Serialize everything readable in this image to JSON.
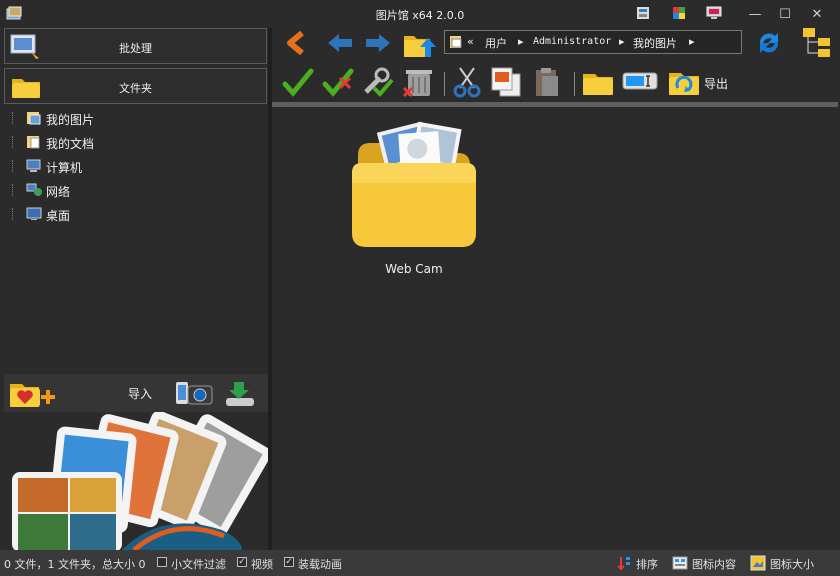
{
  "window": {
    "title": "图片馆 x64 2.0.0",
    "controls": [
      "minimize-icon",
      "maximize-icon",
      "close-icon"
    ]
  },
  "sidebar": {
    "batch_label": "批处理",
    "folder_label": "文件夹",
    "tree": [
      {
        "label": "我的图片",
        "icon": "pictures-folder-icon"
      },
      {
        "label": "我的文档",
        "icon": "documents-folder-icon"
      },
      {
        "label": "计算机",
        "icon": "computer-icon"
      },
      {
        "label": "网络",
        "icon": "network-icon"
      },
      {
        "label": "桌面",
        "icon": "desktop-icon"
      }
    ],
    "import_label": "导入"
  },
  "address": {
    "prefix": "«",
    "segments": [
      "用户",
      "Administrator",
      "我的图片"
    ]
  },
  "toolbar": {
    "export_label": "导出"
  },
  "content": {
    "items": [
      {
        "label": "Web Cam",
        "icon": "folder-icon"
      }
    ]
  },
  "status": {
    "summary": "0 文件，1 文件夹，总大小 0",
    "small_file_filter": {
      "label": "小文件过滤",
      "checked": false
    },
    "video": {
      "label": "视频",
      "checked": true
    },
    "load_animation": {
      "label": "装载动画",
      "checked": true
    },
    "sort_label": "排序",
    "icon_content_label": "图标内容",
    "icon_size_label": "图标大小"
  },
  "colors": {
    "folder": "#f4c430",
    "accent_blue": "#1e88e5",
    "nav_orange": "#e8701a"
  }
}
